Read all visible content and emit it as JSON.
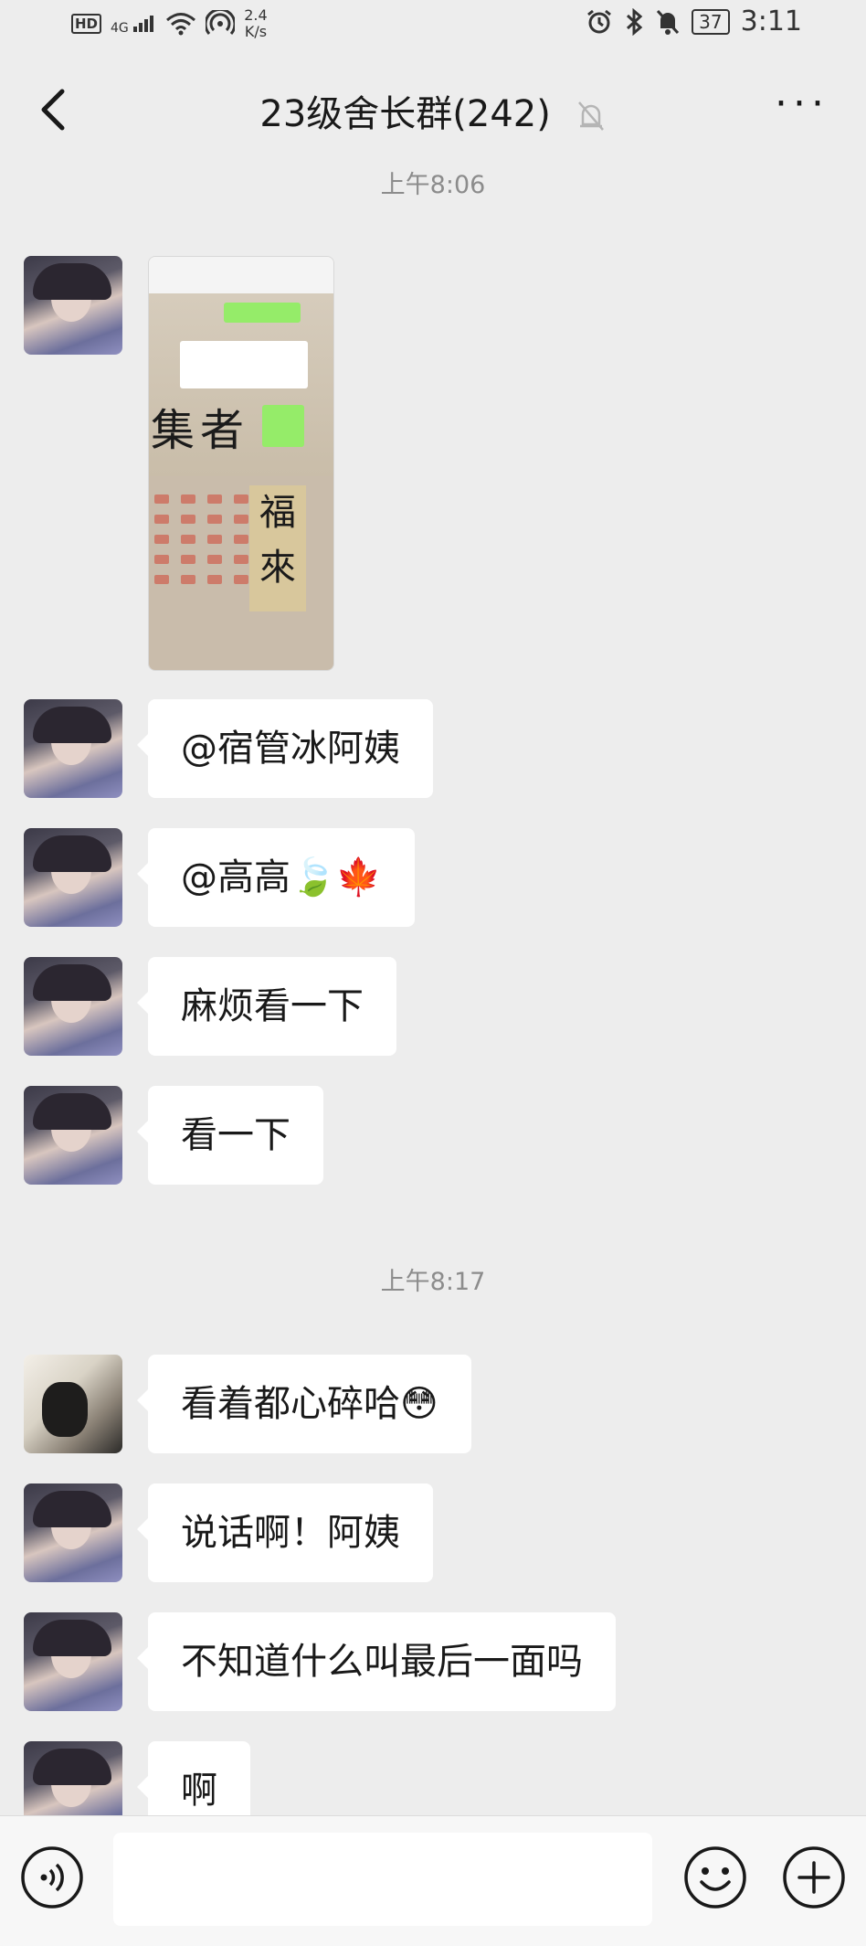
{
  "status_bar": {
    "hd": "HD",
    "network": "4G",
    "speed_value": "2.4",
    "speed_unit": "K/s",
    "battery": "37",
    "time": "3:11"
  },
  "nav": {
    "title": "23级舍长群(242)",
    "more": "···"
  },
  "timestamps": [
    "上午8:06",
    "上午8:17"
  ],
  "image_message": {
    "brush_chars": [
      "集",
      "者",
      "福",
      "來"
    ]
  },
  "messages": [
    {
      "text": "@宿管冰阿姨",
      "emoji": ""
    },
    {
      "text": "@高高",
      "emoji": "🍃🍁"
    },
    {
      "text": "麻烦看一下",
      "emoji": ""
    },
    {
      "text": "看一下",
      "emoji": ""
    },
    {
      "text": "看着都心碎哈",
      "emoji": "😳"
    },
    {
      "text": "说话啊！阿姨",
      "emoji": ""
    },
    {
      "text": "不知道什么叫最后一面吗",
      "emoji": ""
    },
    {
      "text": "啊",
      "emoji": ""
    }
  ],
  "icons": {
    "back": "chevron-left-icon",
    "mute": "bell-muted-icon",
    "voice": "voice-icon",
    "emoji": "smiley-icon",
    "plus": "plus-icon"
  }
}
